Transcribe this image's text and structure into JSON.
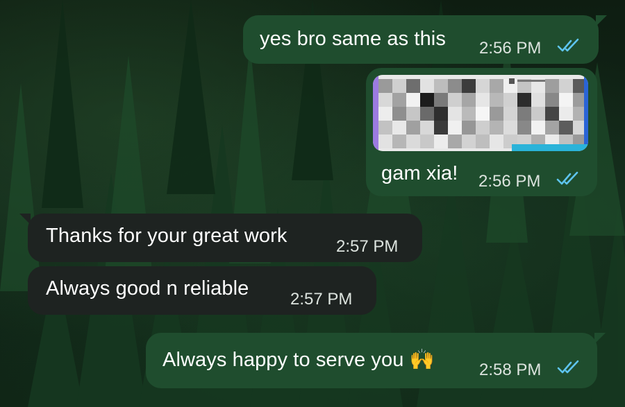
{
  "chat": {
    "messages": [
      {
        "direction": "outgoing",
        "text": "yes bro same as this",
        "time": "2:56 PM",
        "status": "read"
      },
      {
        "direction": "outgoing",
        "type": "image",
        "caption": "gam xia!",
        "time": "2:56 PM",
        "status": "read"
      },
      {
        "direction": "incoming",
        "text": "Thanks for your great work",
        "time": "2:57 PM"
      },
      {
        "direction": "incoming",
        "text": "Always good n reliable",
        "time": "2:57 PM"
      },
      {
        "direction": "outgoing",
        "text": "Always happy to serve you 🙌",
        "time": "2:58 PM",
        "status": "read"
      }
    ]
  },
  "theme": {
    "outgoing_bubble": "#1f4d2e",
    "incoming_bubble": "#1e2321",
    "read_tick_color": "#5ec4f0",
    "wallpaper": "dark pine forest"
  },
  "icons": {
    "read_status": "double-check-icon",
    "emoji": "raising-hands-emoji"
  }
}
